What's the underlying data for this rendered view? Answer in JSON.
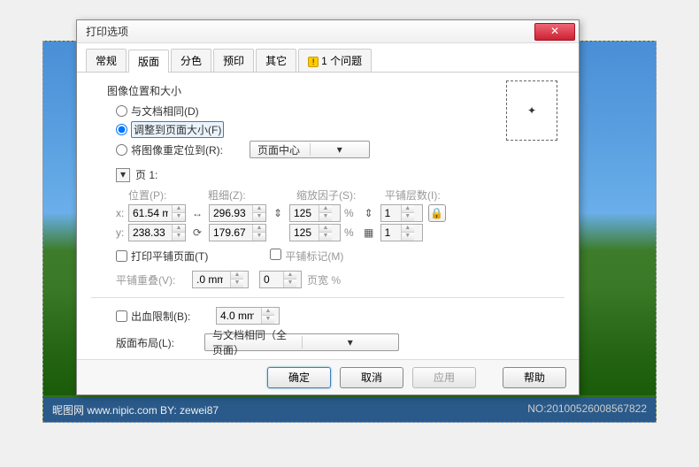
{
  "dialog": {
    "title": "打印选项"
  },
  "tabs": [
    "常规",
    "版面",
    "分色",
    "预印",
    "其它",
    "1 个问题"
  ],
  "section": {
    "positionSize": "图像位置和大小",
    "opt1": "与文档相同(D)",
    "opt2": "调整到页面大小(F)",
    "opt3": "将图像重定位到(R):",
    "repositionValue": "页面中心"
  },
  "page": {
    "toggleLabel": "页 1:",
    "position": "位置(P):",
    "thickness": "粗细(Z):",
    "scale": "缩放因子(S):",
    "tiles": "平铺层数(I):",
    "x": "x:",
    "y": "y:",
    "xv": "61.54 m",
    "yv": "238.33",
    "w": "296.93",
    "h": "179.67",
    "sx": "125",
    "sy": "125",
    "pct": "%",
    "tx": "1",
    "ty": "1"
  },
  "tiling": {
    "print": "打印平铺页面(T)",
    "marks": "平铺标记(M)",
    "overlap": "平铺重叠(V):",
    "ov": ".0 mm",
    "pw": "0",
    "pwlabel": "页宽 %"
  },
  "bleed": {
    "label": "出血限制(B):",
    "value": "4.0 mm"
  },
  "layout": {
    "label": "版面布局(L):",
    "value": "与文档相同（全页面）"
  },
  "buttons": {
    "ok": "确定",
    "cancel": "取消",
    "apply": "应用",
    "help": "帮助"
  },
  "bg": {
    "left": "昵图网  www.nipic.com  BY: zewei87",
    "right": "NO:20100526008567822"
  }
}
